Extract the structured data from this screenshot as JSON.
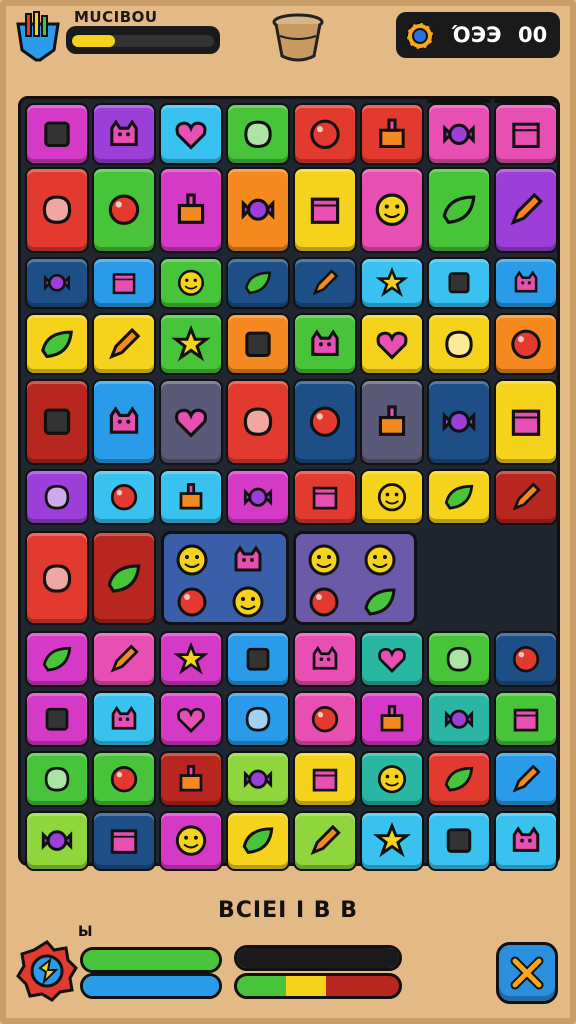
{
  "header": {
    "title": "MUCIBOU",
    "progress": 0.3,
    "progress_color": "#f5d21c",
    "score_left": "ΌЭЭ",
    "score_right": "00"
  },
  "board": {
    "palette": {
      "pink": "#e84fb3",
      "magenta": "#d53ac6",
      "purple": "#9b3fd8",
      "blue": "#2a9be8",
      "lightblue": "#39c1f0",
      "green": "#48c43a",
      "lime": "#8ed63c",
      "yellow": "#f5d21c",
      "orange": "#f3891f",
      "red": "#e23a2f",
      "darkred": "#b7261f",
      "navy": "#1d4f86",
      "teal": "#29b6a3",
      "gray": "#5a5a78"
    },
    "icons": [
      "square",
      "cake",
      "pencil",
      "blob",
      "face",
      "monster",
      "candy",
      "cup",
      "star",
      "ball",
      "leaf",
      "plant",
      "box",
      "cat",
      "heart"
    ]
  },
  "footer": {
    "label": "BCIEI I B B",
    "power_count": "Ы",
    "bar1_color": "#48c43a",
    "bar2_color": "#2a9be8",
    "bar3_color": "#1a1a1a",
    "bar4_colors": [
      "#48c43a",
      "#f5d21c",
      "#b7261f"
    ]
  }
}
